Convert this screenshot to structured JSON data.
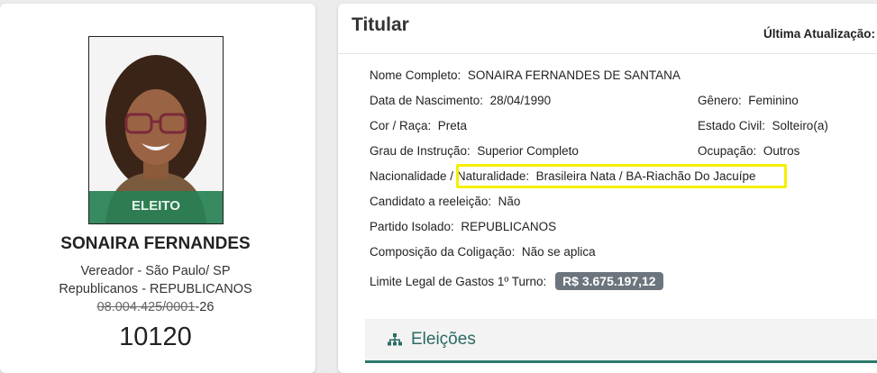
{
  "candidate": {
    "status": "ELEITO",
    "name": "SONAIRA FERNANDES",
    "office": "Vereador - São Paulo/ SP",
    "party_line": "Republicanos - REPUBLICANOS",
    "cnpj_struck": "08.004.425/0001",
    "cnpj_suffix": "-26",
    "number": "10120"
  },
  "header": {
    "title": "Titular",
    "last_update_label": "Última Atualização:"
  },
  "fields": {
    "nome_label": "Nome Completo:",
    "nome_value": "SONAIRA FERNANDES DE SANTANA",
    "nasc_label": "Data de Nascimento:",
    "nasc_value": "28/04/1990",
    "genero_label": "Gênero:",
    "genero_value": "Feminino",
    "cor_label": "Cor / Raça:",
    "cor_value": "Preta",
    "civil_label": "Estado Civil:",
    "civil_value": "Solteiro(a)",
    "grau_label": "Grau de Instrução:",
    "grau_value": "Superior Completo",
    "ocup_label": "Ocupação:",
    "ocup_value": "Outros",
    "nac_label": "Nacionalidade / Naturalidade:",
    "nac_value": "Brasileira Nata / BA-Riachão Do Jacuípe",
    "reel_label": "Candidato a reeleição:",
    "reel_value": "Não",
    "partido_label": "Partido Isolado:",
    "partido_value": "REPUBLICANOS",
    "colig_label": "Composição da Coligação:",
    "colig_value": "Não se aplica",
    "limite_label": "Limite Legal de Gastos 1º Turno:",
    "limite_value": "R$ 3.675.197,12"
  },
  "eleicoes": {
    "label": "Eleições",
    "icon": "sitemap-icon"
  },
  "colors": {
    "accent_green": "#278054",
    "teal": "#2b7a6b",
    "highlight": "#f5f000",
    "badge": "#6c757d"
  }
}
